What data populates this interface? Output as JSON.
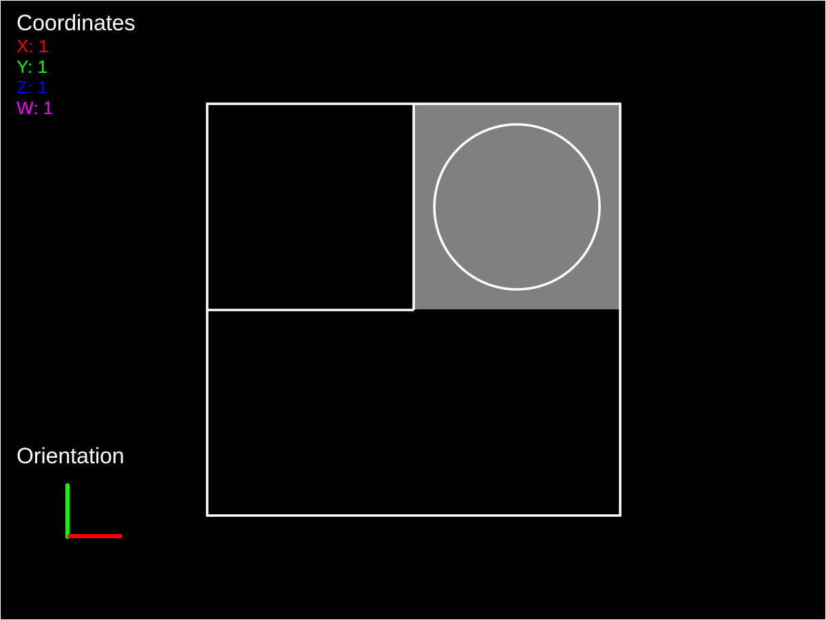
{
  "hud": {
    "coordinates_title": "Coordinates",
    "x": "X: 1",
    "y": "Y: 1",
    "z": "Z: 1",
    "w": "W: 1",
    "orientation_title": "Orientation"
  },
  "colors": {
    "background": "#000000",
    "grid_line": "#ffffff",
    "active_cell": "#808080",
    "x_axis": "#ff0000",
    "y_axis": "#00ff00",
    "z_axis": "#0000ff",
    "w_axis": "#ff00ff"
  },
  "board": {
    "rows": 2,
    "columns": 2,
    "active_cell": "top-right",
    "active_cell_marker": "circle"
  }
}
